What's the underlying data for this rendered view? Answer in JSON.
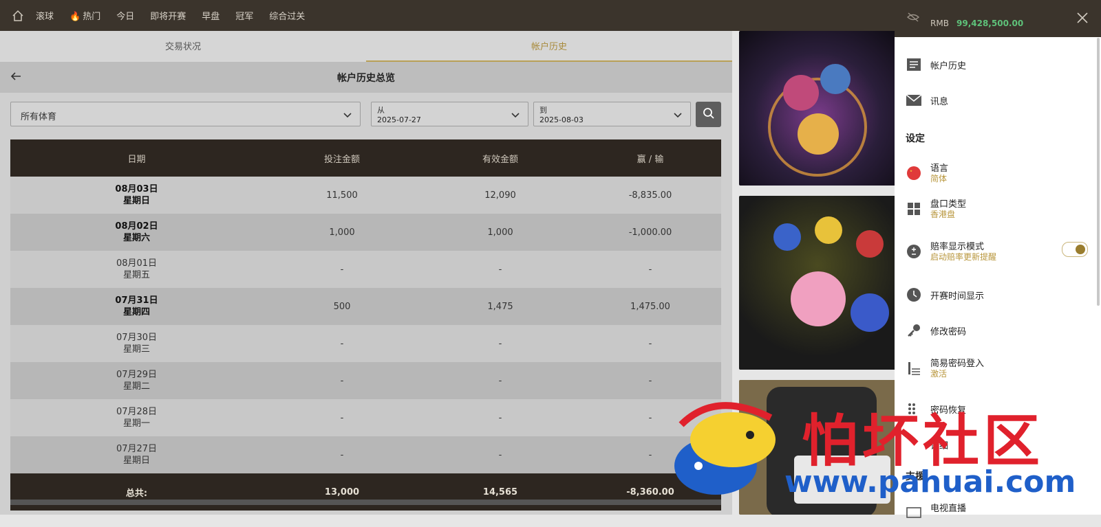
{
  "nav": {
    "items": [
      "滚球",
      "热门",
      "今日",
      "即将开赛",
      "早盘",
      "冠军",
      "综合过关"
    ]
  },
  "tabs": [
    "交易状况",
    "帐户历史"
  ],
  "page_title": "帐户历史总览",
  "filters": {
    "sport": "所有体育",
    "from_label": "从",
    "from_value": "2025-07-27",
    "to_label": "到",
    "to_value": "2025-08-03"
  },
  "table": {
    "headers": [
      "日期",
      "投注金额",
      "有效金额",
      "赢 / 输"
    ],
    "rows": [
      {
        "date": "08月03日",
        "weekday": "星期日",
        "bet": "11,500",
        "valid": "12,090",
        "winloss": "-8,835.00"
      },
      {
        "date": "08月02日",
        "weekday": "星期六",
        "bet": "1,000",
        "valid": "1,000",
        "winloss": "-1,000.00"
      },
      {
        "date": "08月01日",
        "weekday": "星期五",
        "bet": "-",
        "valid": "-",
        "winloss": "-"
      },
      {
        "date": "07月31日",
        "weekday": "星期四",
        "bet": "500",
        "valid": "1,475",
        "winloss": "1,475.00"
      },
      {
        "date": "07月30日",
        "weekday": "星期三",
        "bet": "-",
        "valid": "-",
        "winloss": "-"
      },
      {
        "date": "07月29日",
        "weekday": "星期二",
        "bet": "-",
        "valid": "-",
        "winloss": "-"
      },
      {
        "date": "07月28日",
        "weekday": "星期一",
        "bet": "-",
        "valid": "-",
        "winloss": "-"
      },
      {
        "date": "07月27日",
        "weekday": "星期日",
        "bet": "-",
        "valid": "-",
        "winloss": "-"
      }
    ],
    "total": {
      "label": "总共:",
      "bet": "13,000",
      "valid": "14,565",
      "winloss": "-8,360.00"
    }
  },
  "panel": {
    "currency": "RMB",
    "balance": "99,428,500.00",
    "items": {
      "history": "帐户历史",
      "messages": "讯息",
      "settings_title": "设定",
      "language": "语言",
      "language_value": "简体",
      "odds_type": "盘口类型",
      "odds_type_value": "香港盘",
      "odds_mode": "赔率显示模式",
      "odds_mode_value": "启动赔率更新提醒",
      "kickoff": "开赛时间显示",
      "change_password": "修改密码",
      "easy_login": "简易密码登入",
      "easy_login_value": "激活",
      "password_recovery": "密码恢复",
      "details": "详细",
      "support_title": "支援",
      "tv": "电视直播"
    }
  },
  "watermark": {
    "text": "怕坏社区",
    "url": "www.pahuai.com"
  },
  "colors": {
    "topbar": "#3b342c",
    "accent_gold": "#b8963c",
    "negative": "#b03a3a",
    "positive": "#2f8a4a",
    "balance": "#5ec27a"
  }
}
